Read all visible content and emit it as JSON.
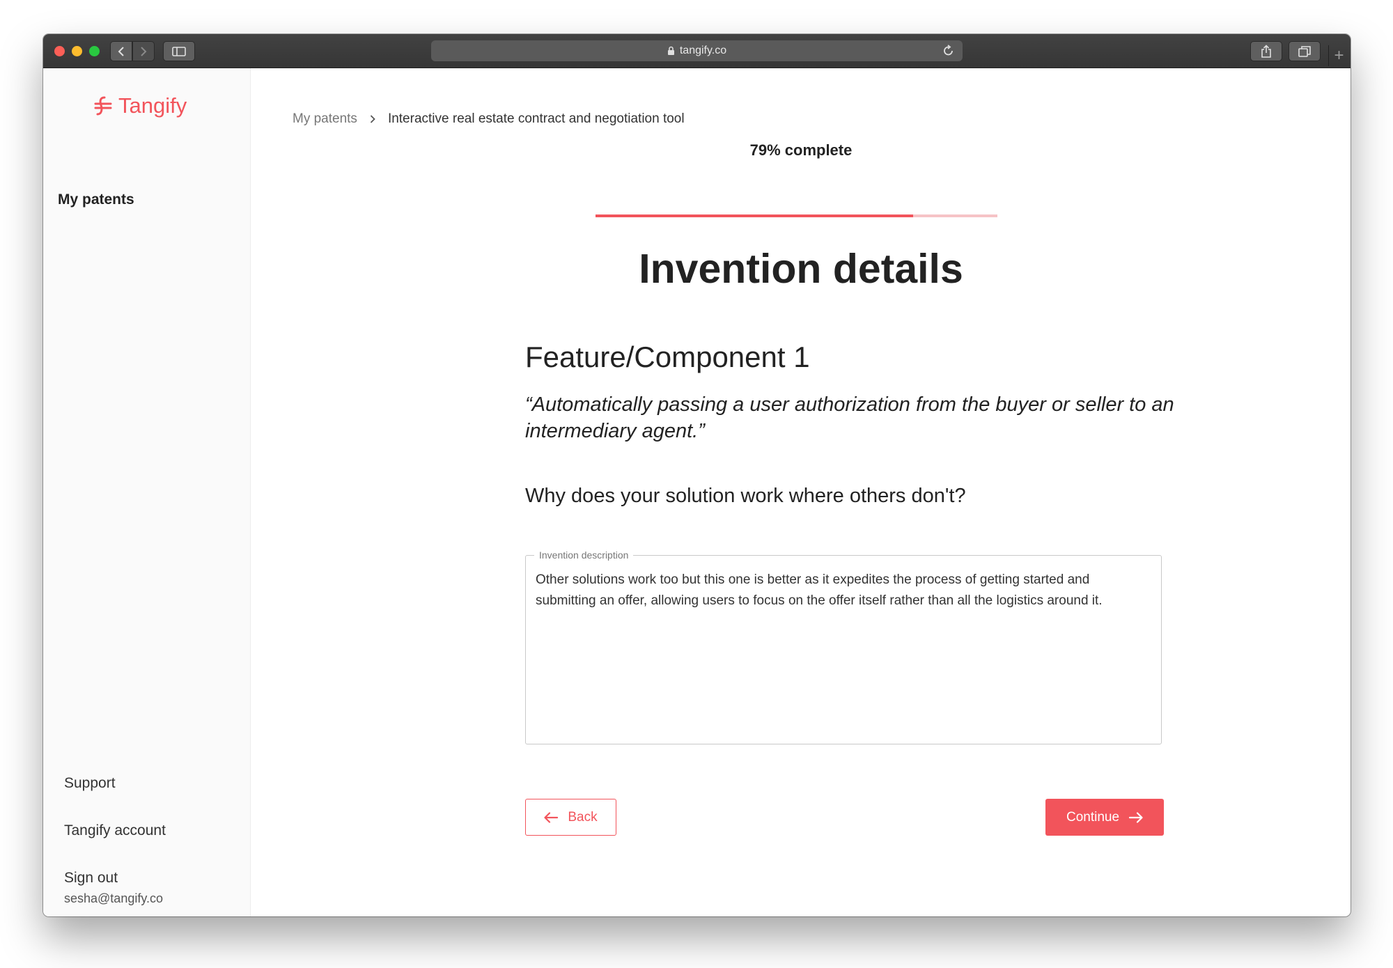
{
  "browser": {
    "url": "tangify.co"
  },
  "sidebar": {
    "logo_text": "Tangify",
    "nav_my_patents": "My patents",
    "support": "Support",
    "account": "Tangify account",
    "sign_out": "Sign out",
    "user_email": "sesha@tangify.co"
  },
  "breadcrumb": {
    "root": "My patents",
    "current": "Interactive real estate contract and negotiation tool"
  },
  "progress": {
    "label": "79% complete",
    "fraction": 0.79
  },
  "page": {
    "heading": "Invention details",
    "feature_title": "Feature/Component 1",
    "feature_quote": "“Automatically passing a user authorization from the buyer or seller to an intermediary agent.”",
    "question": "Why does your solution work where others don't?"
  },
  "description_field": {
    "label": "Invention description",
    "value": "Other solutions work too but this one is better as it expedites the process of getting started and submitting an offer, allowing users to focus on the offer itself rather than all the logistics around it."
  },
  "actions": {
    "back_label": "Back",
    "continue_label": "Continue"
  },
  "colors": {
    "accent": "#f2545b",
    "accent_light": "#f6c3c6"
  }
}
